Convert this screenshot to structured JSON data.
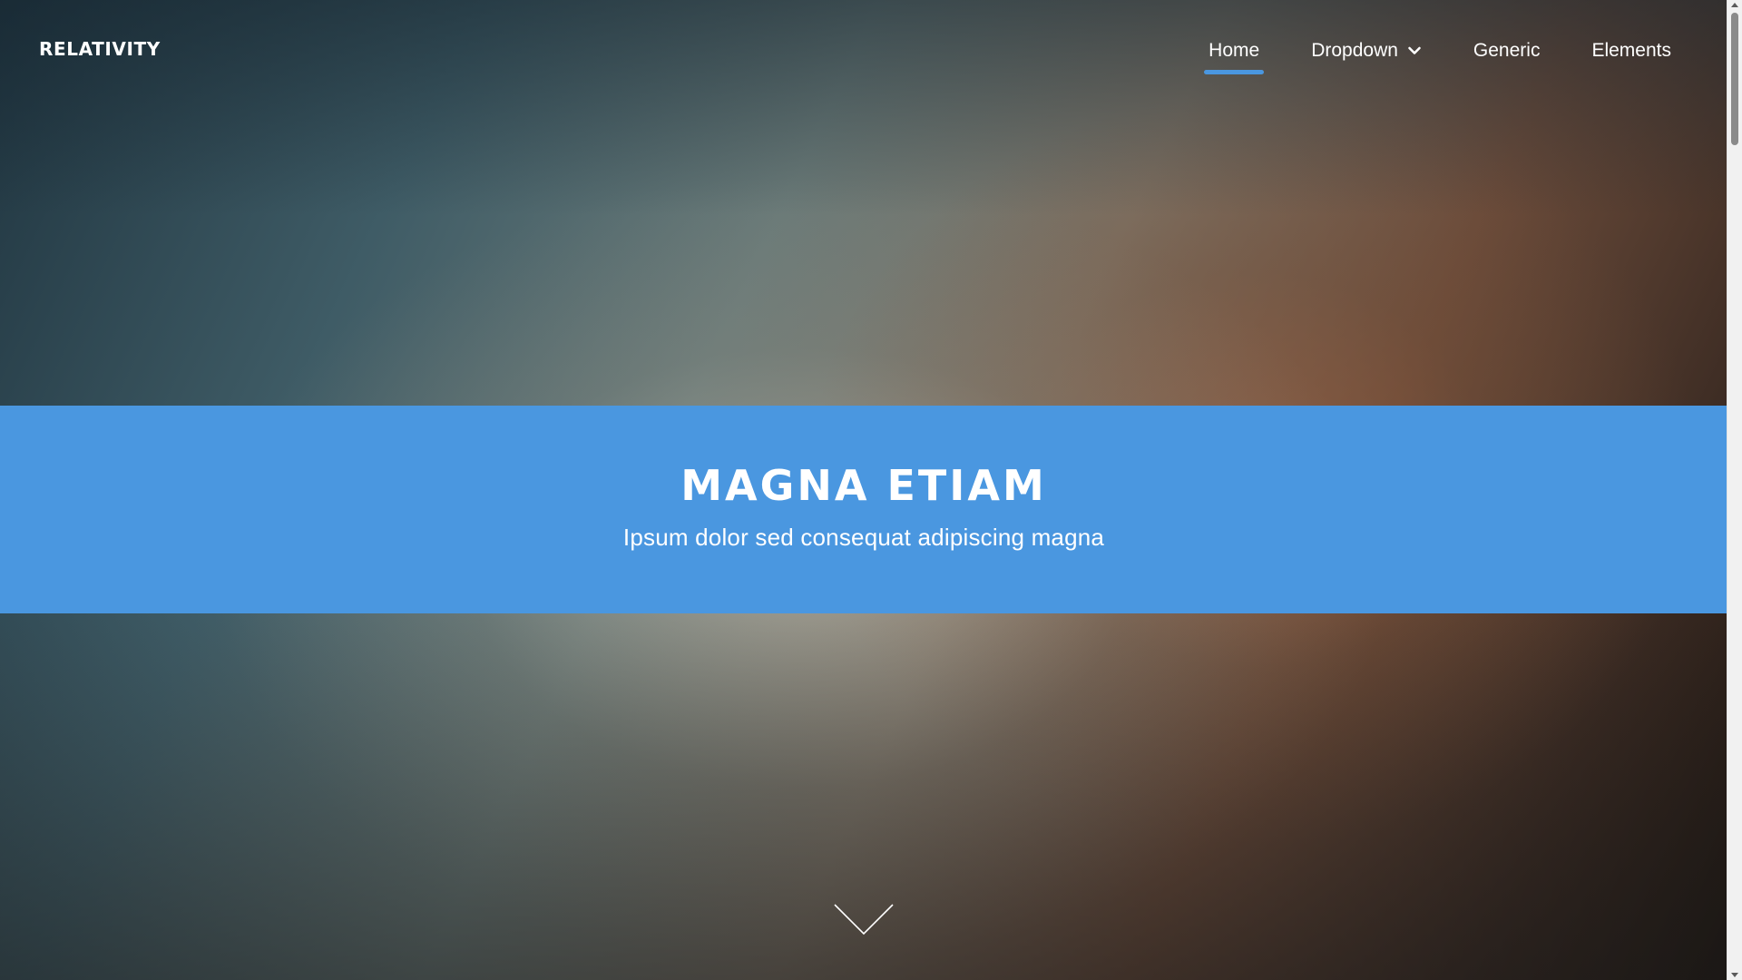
{
  "header": {
    "logo": "RELATIVITY"
  },
  "nav": {
    "items": [
      {
        "label": "Home",
        "active": true
      },
      {
        "label": "Dropdown",
        "has_dropdown": true,
        "icon": "chevron-down-icon"
      },
      {
        "label": "Generic"
      },
      {
        "label": "Elements"
      }
    ]
  },
  "banner": {
    "title": "MAGNA ETIAM",
    "subtitle": "Ipsum dolor sed consequat adipiscing magna"
  },
  "scroll_arrow": {
    "icon": "chevron-down-icon"
  },
  "colors": {
    "accent": "#4a97e0",
    "text": "#ffffff"
  }
}
